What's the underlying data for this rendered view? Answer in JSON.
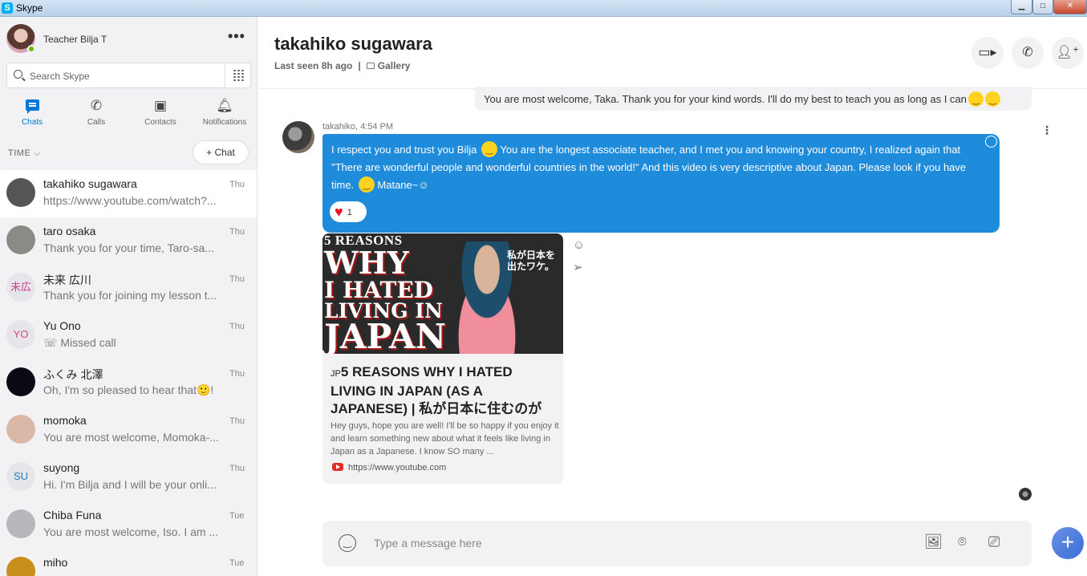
{
  "window": {
    "title": "Skype",
    "buttons": {
      "minimize": "▁",
      "maximize": "□",
      "close": "✕"
    }
  },
  "sidebar": {
    "profile_name": "Teacher Bilja T",
    "more": "•••",
    "search_placeholder": "Search Skype",
    "nav": [
      {
        "label": "Chats",
        "icon": "chat-icon",
        "active": true
      },
      {
        "label": "Calls",
        "icon": "phone-icon"
      },
      {
        "label": "Contacts",
        "icon": "contacts-icon"
      },
      {
        "label": "Notifications",
        "icon": "bell-icon"
      }
    ],
    "sort_label": "TIME",
    "new_chat_label": "Chat",
    "chats": [
      {
        "name": "takahiko sugawara",
        "date": "Thu",
        "preview": "https://www.youtube.com/watch?...",
        "avatar_text": "",
        "avatar_bg": "#555555",
        "selected": true
      },
      {
        "name": "taro osaka",
        "date": "Thu",
        "preview": "Thank you for your time, Taro-sa...",
        "avatar_text": "",
        "avatar_bg": "#8a8a86"
      },
      {
        "name": "未来 広川",
        "date": "Thu",
        "preview": "Thank you for joining my lesson t...",
        "avatar_text": "未広",
        "avatar_bg": "#e6e6ea",
        "avatar_color": "#c8408a"
      },
      {
        "name": "Yu Ono",
        "date": "Thu",
        "preview": "☏ Missed call",
        "avatar_text": "YO",
        "avatar_bg": "#e6e6ea",
        "avatar_color": "#e0407a"
      },
      {
        "name": "ふくみ 北澤",
        "date": "Thu",
        "preview": "Oh, I'm so pleased to hear that🙂!",
        "avatar_text": "",
        "avatar_bg": "#0a0a14"
      },
      {
        "name": "momoka",
        "date": "Thu",
        "preview": "You are most welcome, Momoka-...",
        "avatar_text": "",
        "avatar_bg": "#d9b8a8"
      },
      {
        "name": "suyong",
        "date": "Thu",
        "preview": "Hi. I'm Bilja and I will be your onli...",
        "avatar_text": "SU",
        "avatar_bg": "#e6e6ea",
        "avatar_color": "#2a7ab8"
      },
      {
        "name": "Chiba Funa",
        "date": "Tue",
        "preview": "You are most welcome, Iso. I am ...",
        "avatar_text": "",
        "avatar_bg": "#b8b8bc"
      },
      {
        "name": "miho",
        "date": "Tue",
        "preview": "",
        "avatar_text": "",
        "avatar_bg": "#c8901a"
      }
    ]
  },
  "conversation": {
    "name": "takahiko sugawara",
    "last_seen": "Last seen 8h ago",
    "separator": "|",
    "gallery_label": "Gallery",
    "my_message": "You are most welcome, Taka. Thank you for your kind words. I'll do my best to teach you as long as I can",
    "sender_meta": "takahiko, 4:54 PM",
    "message": {
      "part1": "I respect you and trust you    Bilja ",
      "part2": " You are the longest associate teacher, and I met you and knowing your country, I realized again that \"There are wonderful people and wonderful countries in the world!\" And this video is very descriptive about Japan. Please look if you have time. ",
      "part3": "   Matane~☺"
    },
    "reaction_count": "1",
    "link_card": {
      "thumb_top": "5 REASONS",
      "thumb_lines": [
        "WHY",
        "I HATED",
        "LIVING IN",
        "JAPAN"
      ],
      "thumb_jp": "私が日本を出たワケ。",
      "flag": "JP",
      "title": "5 REASONS WHY I HATED LIVING IN JAPAN (AS A JAPANESE) | 私が日本に住むのが",
      "description": "Hey guys, hope you are well! I'll be so happy if you enjoy it and learn something new about what it feels like living in Japan as a Japanese. I know SO many ...",
      "url": "https://www.youtube.com"
    },
    "composer_placeholder": "Type a message here"
  },
  "colors": {
    "accent": "#0078d4",
    "bubble": "#1f8bdb",
    "panel": "#f2f2f4"
  }
}
